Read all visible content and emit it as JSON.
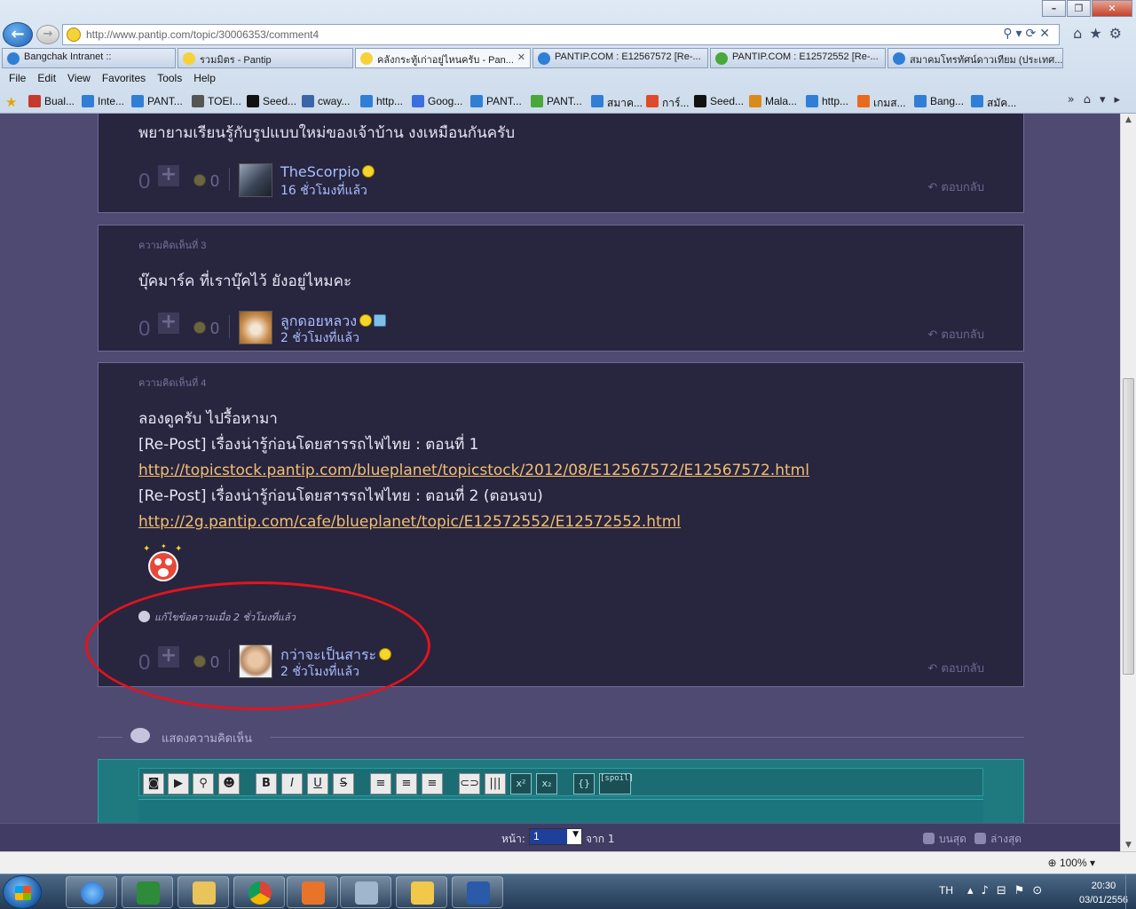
{
  "browser": {
    "url": "http://www.pantip.com/topic/30006353/comment4",
    "tabs": [
      {
        "label": "Bangchak Intranet ::",
        "icon": "ie-icon"
      },
      {
        "label": "รวมมิตร - Pantip",
        "icon": "pantip-icon"
      },
      {
        "label": "คลังกระทู้เก่าอยู่ไหนครับ - Pan...",
        "icon": "pantip-icon",
        "active": true
      },
      {
        "label": "PANTIP.COM : E12567572 [Re-...",
        "icon": "ie-icon"
      },
      {
        "label": "PANTIP.COM : E12572552 [Re-...",
        "icon": "cactus-icon"
      },
      {
        "label": "สมาคมโทรทัศน์ดาวเทียม (ประเทศ...",
        "icon": "ie-icon"
      }
    ],
    "menu": [
      "File",
      "Edit",
      "View",
      "Favorites",
      "Tools",
      "Help"
    ],
    "favorites": [
      "Bual...",
      "Inte...",
      "PANT...",
      "TOEI...",
      "Seed...",
      "cway...",
      "http...",
      "Goog...",
      "PANT...",
      "PANT...",
      "สมาค...",
      "การ์...",
      "Seed...",
      "Mala...",
      "http...",
      "เกมส...",
      "Bang...",
      "สมัค..."
    ],
    "zoom": "100%"
  },
  "comments": [
    {
      "number": "",
      "text": [
        "พยายามเรียนรู้กับรูปแบบใหม่ของเจ้าบ้าน งงเหมือนกันครับ"
      ],
      "links": [],
      "votes": "0",
      "emotions": "0",
      "user": "TheScorpio",
      "time": "16 ชั่วโมงที่แล้ว",
      "reply": "ตอบกลับ"
    },
    {
      "number": "ความคิดเห็นที่ 3",
      "text": [
        "บุ๊คมาร์ค ที่เราบุ๊คไว้ ยังอยู่ไหมคะ"
      ],
      "links": [],
      "votes": "0",
      "emotions": "0",
      "user": "ลูกดอยหลวง",
      "time": "2 ชั่วโมงที่แล้ว",
      "reply": "ตอบกลับ"
    },
    {
      "number": "ความคิดเห็นที่ 4",
      "line1": "ลองดูครับ  ไปรื้อหามา",
      "line2": "[Re-Post] เรื่องน่ารู้ก่อนโดยสารรถไฟไทย : ตอนที่ 1",
      "link1": "http://topicstock.pantip.com/blueplanet/topicstock/2012/08/E12567572/E12567572.html",
      "line3": "[Re-Post] เรื่องน่ารู้ก่อนโดยสารรถไฟไทย : ตอนที่ 2 (ตอนจบ)",
      "link2": "http://2g.pantip.com/cafe/blueplanet/topic/E12572552/E12572552.html",
      "edited": "แก้ไขข้อความเมื่อ 2 ชั่วโมงที่แล้ว",
      "votes": "0",
      "emotions": "0",
      "user": "กว่าจะเป็นสาระ",
      "time": "2 ชั่วโมงที่แล้ว",
      "reply": "ตอบกลับ"
    }
  ],
  "compose": {
    "title": "แสดงความคิดเห็น",
    "toolbar": [
      "camera",
      "video",
      "map-pin",
      "emoticon",
      "B",
      "I",
      "U",
      "S",
      "align-left",
      "align-center",
      "align-right",
      "link",
      "code-block",
      "x2",
      "x2",
      "{}",
      "[spoil]"
    ]
  },
  "pager": {
    "label": "หน้า:",
    "current": "1",
    "of": "จาก 1",
    "top": "บนสุด",
    "bottom": "ล่างสุด"
  },
  "taskbar": {
    "lang": "TH",
    "time": "20:30",
    "date": "03/01/2556"
  },
  "colors": {
    "page_bg": "#4e4a72",
    "card_bg": "#28253f",
    "link": "#f2bf72",
    "username": "#a9bfff",
    "highlight_circle": "#e0141e",
    "editor_bg": "#1f7a80"
  }
}
